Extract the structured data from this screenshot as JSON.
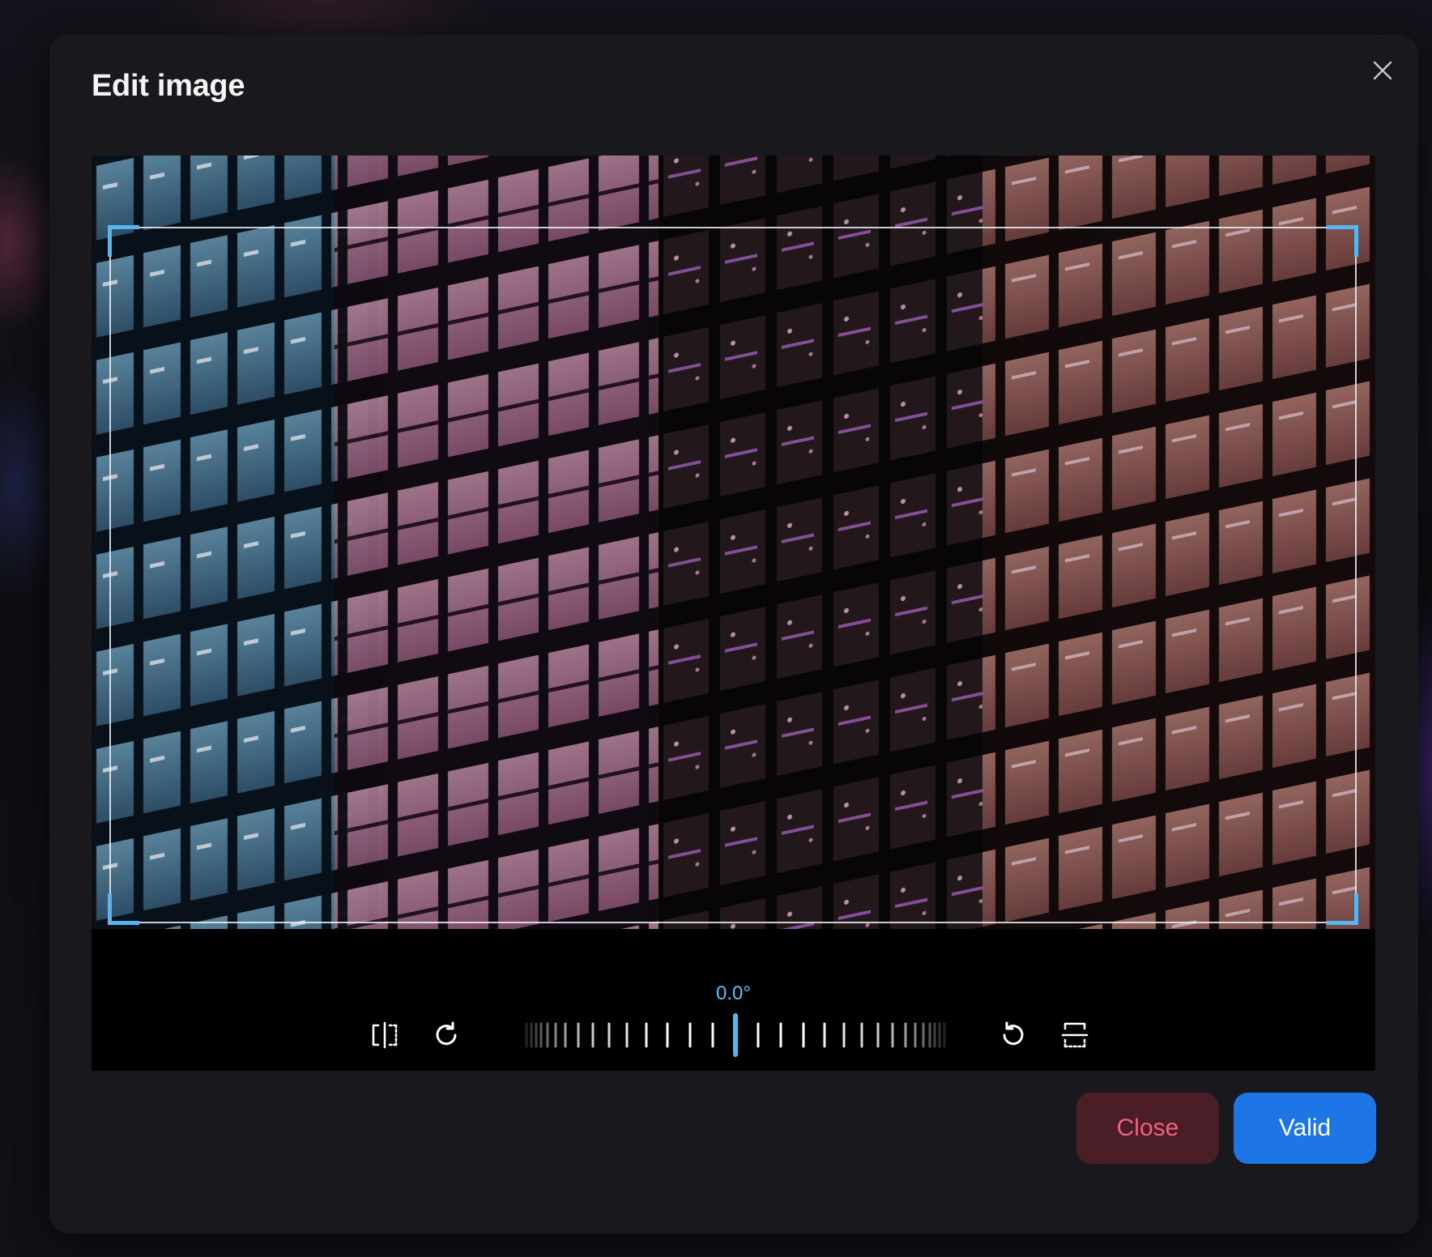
{
  "modal": {
    "title": "Edit image"
  },
  "editor": {
    "rotation_readout": "0.0°",
    "rotation_degrees": 0,
    "tools": {
      "left": [
        "flip-horizontal-icon",
        "rotate-clockwise-icon"
      ],
      "right": [
        "rotate-counterclockwise-icon",
        "flip-vertical-icon"
      ]
    }
  },
  "actions": {
    "close_label": "Close",
    "valid_label": "Valid"
  },
  "colors": {
    "accent": "#56b6f0",
    "modal_bg": "#19191d",
    "close_button_bg": "#4a1d27",
    "close_button_text": "#f06384",
    "valid_button_bg": "#1d75e6"
  }
}
